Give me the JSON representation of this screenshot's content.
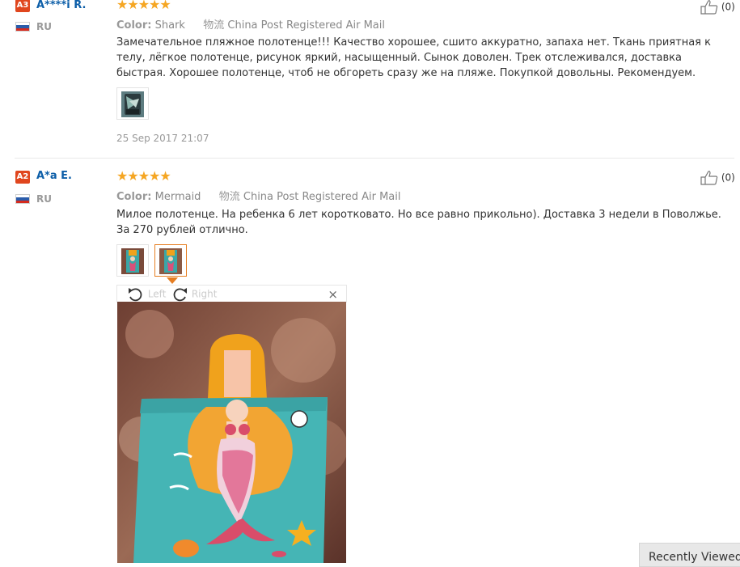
{
  "reviews": [
    {
      "badge": "A3",
      "badge_color": "#e0461e",
      "name": "A****i R.",
      "country": "RU",
      "stars": "★★★★★",
      "color_label": "Color:",
      "color_value": "Shark",
      "shipping_label": "物流",
      "shipping_value": "China Post Registered Air Mail",
      "text": "Замечательное пляжное полотенце!!! Качество хорошее, сшито аккуратно, запаха нет. Ткань приятная к телу, лёгкое полотенце, рисунок яркий, насыщенный. Сынок доволен. Трек отслеживался, доставка быстрая. Хорошее полотенце, чтоб не обгореть сразу же на пляже. Покупкой довольны. Рекомендуем.",
      "date": "25 Sep 2017 21:07",
      "likes": "(0)"
    },
    {
      "badge": "A2",
      "badge_color": "#e0461e",
      "name": "A*a E.",
      "country": "RU",
      "stars": "★★★★★",
      "color_label": "Color:",
      "color_value": "Mermaid",
      "shipping_label": "物流",
      "shipping_value": "China Post Registered Air Mail",
      "text": "Милое полотенце. На ребенка 6 лет коротковато. Но все равно прикольно). Доставка 3 недели в Поволжье. За 270 рублей отлично.",
      "likes": "(0)"
    }
  ],
  "viewer": {
    "rotate_left": "Left",
    "rotate_right": "Right",
    "close": "×"
  },
  "recently_viewed": "Recently Viewed",
  "colors": {
    "star": "#f5a623",
    "name_link": "#0c5ea8",
    "active_thumb": "#e67e22"
  }
}
